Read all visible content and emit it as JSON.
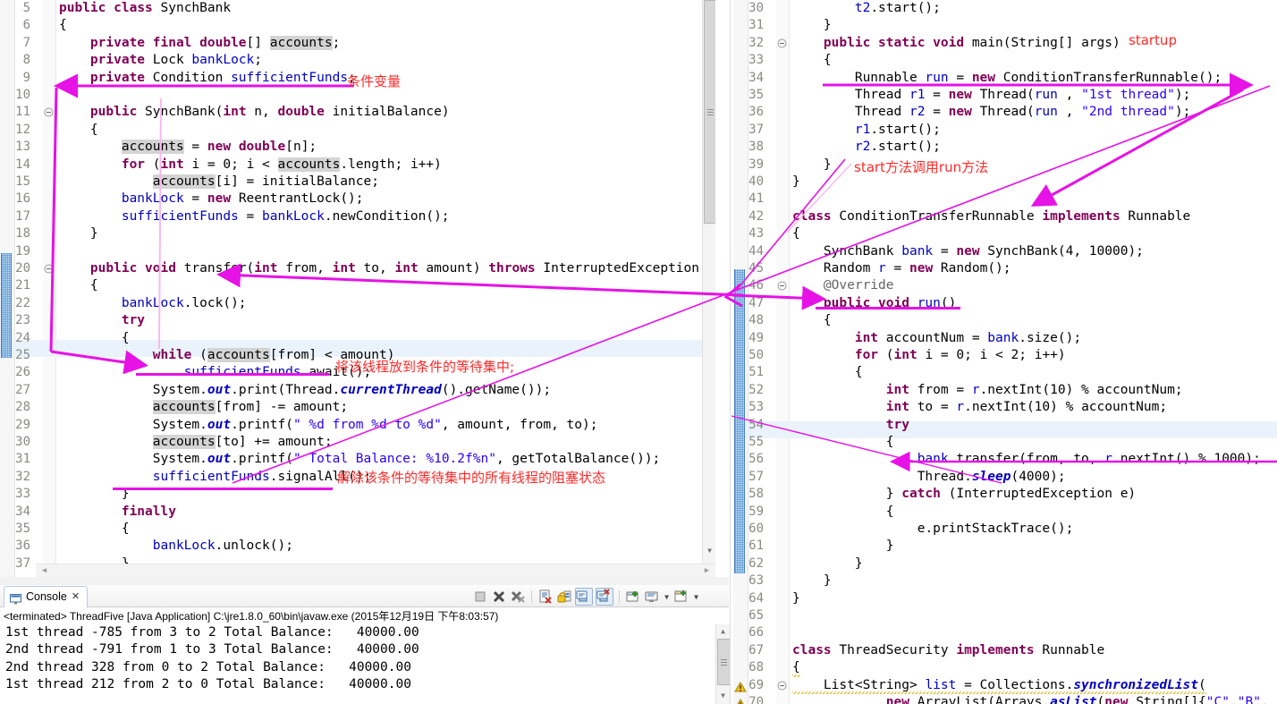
{
  "left_editor": {
    "first_line": 5,
    "lines": [
      {
        "n": 5,
        "fold": "",
        "text": "public class SynchBank"
      },
      {
        "n": 6,
        "fold": "",
        "text": "{"
      },
      {
        "n": 7,
        "fold": "",
        "text": "    private final double[] accounts;"
      },
      {
        "n": 8,
        "fold": "",
        "text": "    private Lock bankLock;"
      },
      {
        "n": 9,
        "fold": "",
        "text": "    private Condition sufficientFunds;"
      },
      {
        "n": 10,
        "fold": "",
        "text": ""
      },
      {
        "n": 11,
        "fold": "minus",
        "text": "    public SynchBank(int n, double initialBalance)"
      },
      {
        "n": 12,
        "fold": "",
        "text": "    {"
      },
      {
        "n": 13,
        "fold": "",
        "text": "        accounts = new double[n];"
      },
      {
        "n": 14,
        "fold": "",
        "text": "        for (int i = 0; i < accounts.length; i++)"
      },
      {
        "n": 15,
        "fold": "",
        "text": "            accounts[i] = initialBalance;"
      },
      {
        "n": 16,
        "fold": "",
        "text": "        bankLock = new ReentrantLock();"
      },
      {
        "n": 17,
        "fold": "",
        "text": "        sufficientFunds = bankLock.newCondition();"
      },
      {
        "n": 18,
        "fold": "",
        "text": "    }"
      },
      {
        "n": 19,
        "fold": "",
        "text": ""
      },
      {
        "n": 20,
        "fold": "minus",
        "text": "    public void transfer(int from, int to, int amount) throws InterruptedException"
      },
      {
        "n": 21,
        "fold": "",
        "text": "    {"
      },
      {
        "n": 22,
        "fold": "",
        "text": "        bankLock.lock();"
      },
      {
        "n": 23,
        "fold": "",
        "text": "        try"
      },
      {
        "n": 24,
        "fold": "",
        "text": "        {"
      },
      {
        "n": 25,
        "fold": "",
        "text": "            while (accounts[from] < amount)"
      },
      {
        "n": 26,
        "fold": "",
        "text": "                sufficientFunds.await();"
      },
      {
        "n": 27,
        "fold": "",
        "text": "            System.out.print(Thread.currentThread().getName());"
      },
      {
        "n": 28,
        "fold": "",
        "text": "            accounts[from] -= amount;"
      },
      {
        "n": 29,
        "fold": "",
        "text": "            System.out.printf(\" %d from %d to %d\", amount, from, to);"
      },
      {
        "n": 30,
        "fold": "",
        "text": "            accounts[to] += amount;"
      },
      {
        "n": 31,
        "fold": "",
        "text": "            System.out.printf(\" Total Balance: %10.2f%n\", getTotalBalance());"
      },
      {
        "n": 32,
        "fold": "",
        "text": "            sufficientFunds.signalAll();"
      },
      {
        "n": 33,
        "fold": "",
        "text": "        }"
      },
      {
        "n": 34,
        "fold": "",
        "text": "        finally"
      },
      {
        "n": 35,
        "fold": "",
        "text": "        {"
      },
      {
        "n": 36,
        "fold": "",
        "text": "            bankLock.unlock();"
      },
      {
        "n": 37,
        "fold": "",
        "text": "        }"
      }
    ],
    "current_line": 25,
    "change_bar_from": 20,
    "change_bar_to": 25
  },
  "right_editor": {
    "lines": [
      {
        "n": 30,
        "fold": "",
        "text": "        t2.start();"
      },
      {
        "n": 31,
        "fold": "",
        "text": "    }"
      },
      {
        "n": 32,
        "fold": "minus",
        "text": "    public static void main(String[] args)"
      },
      {
        "n": 33,
        "fold": "",
        "text": "    {"
      },
      {
        "n": 34,
        "fold": "",
        "text": "        Runnable run = new ConditionTransferRunnable();"
      },
      {
        "n": 35,
        "fold": "",
        "text": "        Thread r1 = new Thread(run , \"1st thread\");"
      },
      {
        "n": 36,
        "fold": "",
        "text": "        Thread r2 = new Thread(run , \"2nd thread\");"
      },
      {
        "n": 37,
        "fold": "",
        "text": "        r1.start();"
      },
      {
        "n": 38,
        "fold": "",
        "text": "        r2.start();"
      },
      {
        "n": 39,
        "fold": "",
        "text": "    }"
      },
      {
        "n": 40,
        "fold": "",
        "text": "}"
      },
      {
        "n": 41,
        "fold": "",
        "text": ""
      },
      {
        "n": 42,
        "fold": "",
        "text": "class ConditionTransferRunnable implements Runnable"
      },
      {
        "n": 43,
        "fold": "",
        "text": "{"
      },
      {
        "n": 44,
        "fold": "",
        "text": "    SynchBank bank = new SynchBank(4, 10000);"
      },
      {
        "n": 45,
        "fold": "",
        "text": "    Random r = new Random();"
      },
      {
        "n": 46,
        "fold": "minus",
        "text": "    @Override"
      },
      {
        "n": 47,
        "fold": "",
        "text": "    public void run()"
      },
      {
        "n": 48,
        "fold": "",
        "text": "    {"
      },
      {
        "n": 49,
        "fold": "",
        "text": "        int accountNum = bank.size();"
      },
      {
        "n": 50,
        "fold": "",
        "text": "        for (int i = 0; i < 2; i++)"
      },
      {
        "n": 51,
        "fold": "",
        "text": "        {"
      },
      {
        "n": 52,
        "fold": "",
        "text": "            int from = r.nextInt(10) % accountNum;"
      },
      {
        "n": 53,
        "fold": "",
        "text": "            int to = r.nextInt(10) % accountNum;"
      },
      {
        "n": 54,
        "fold": "",
        "text": "            try"
      },
      {
        "n": 55,
        "fold": "",
        "text": "            {"
      },
      {
        "n": 56,
        "fold": "",
        "text": "                bank.transfer(from, to, r.nextInt() % 1000);"
      },
      {
        "n": 57,
        "fold": "",
        "text": "                Thread.sleep(4000);"
      },
      {
        "n": 58,
        "fold": "",
        "text": "            } catch (InterruptedException e)"
      },
      {
        "n": 59,
        "fold": "",
        "text": "            {"
      },
      {
        "n": 60,
        "fold": "",
        "text": "                e.printStackTrace();"
      },
      {
        "n": 61,
        "fold": "",
        "text": "            }"
      },
      {
        "n": 62,
        "fold": "",
        "text": "        }"
      },
      {
        "n": 63,
        "fold": "",
        "text": "    }"
      },
      {
        "n": 64,
        "fold": "",
        "text": "}"
      },
      {
        "n": 65,
        "fold": "",
        "text": ""
      },
      {
        "n": 66,
        "fold": "",
        "text": ""
      },
      {
        "n": 67,
        "fold": "",
        "text": "class ThreadSecurity implements Runnable"
      },
      {
        "n": 68,
        "fold": "",
        "text": "{"
      },
      {
        "n": 69,
        "fold": "minus",
        "text": "    List<String> list = Collections.synchronizedList("
      },
      {
        "n": 70,
        "fold": "",
        "text": "            new ArrayList(Arrays.asList(new String[]{\"C\",\"B\","
      }
    ],
    "current_line": 55,
    "change_bar_from": 46,
    "change_bar_to": 63
  },
  "console": {
    "tab_label": "Console",
    "tab_close_glyph": "✕",
    "terminated_prefix": "<terminated>",
    "launch_description": "<terminated> ThreadFive [Java Application] C:\\jre1.8.0_60\\bin\\javaw.exe (2015年12月19日 下午8:03:57)",
    "output_lines": [
      "1st thread -785 from 3 to 2 Total Balance:   40000.00",
      "2nd thread -791 from 1 to 3 Total Balance:   40000.00",
      "2nd thread 328 from 0 to 2 Total Balance:   40000.00",
      "1st thread 212 from 2 to 0 Total Balance:   40000.00"
    ],
    "toolbar": [
      {
        "name": "terminate-button",
        "label": "Terminate"
      },
      {
        "name": "remove-launch-button",
        "label": "Remove Launch"
      },
      {
        "name": "remove-all-terminated-button",
        "label": "Remove All Terminated Launches"
      },
      {
        "name": "clear-console-button",
        "label": "Clear Console"
      },
      {
        "name": "scroll-lock-button",
        "label": "Scroll Lock"
      },
      {
        "name": "show-console-on-output-button",
        "label": "Show Console When Standard Out Changes"
      },
      {
        "name": "show-console-on-error-button",
        "label": "Show Console When Standard Error Changes"
      },
      {
        "name": "pin-console-button",
        "label": "Pin Console"
      },
      {
        "name": "display-selected-console-button",
        "label": "Display Selected Console"
      },
      {
        "name": "open-console-button",
        "label": "Open Console"
      }
    ]
  },
  "annotations": [
    {
      "id": "a1",
      "text": "条件变量"
    },
    {
      "id": "a2",
      "text": "将该线程放到条件的等待集中;"
    },
    {
      "id": "a3",
      "text": "解除该条件的等待集中的所有线程的阻塞状态"
    },
    {
      "id": "a4",
      "text": "startup"
    },
    {
      "id": "a5",
      "text": "start方法调用run方法"
    }
  ],
  "colors": {
    "annotation_red": "#ff2a2a",
    "arrow_magenta": "#e612e6",
    "keyword_purple": "#7f0055",
    "string_blue": "#2a00ff",
    "field_blue": "#0000c0",
    "current_line": "#eaf2fb",
    "change_bar": "#6fa8dc"
  }
}
